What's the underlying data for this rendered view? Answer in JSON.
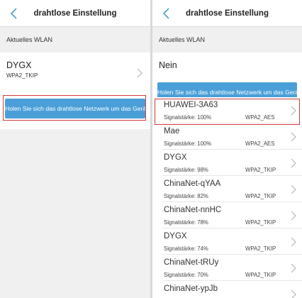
{
  "colors": {
    "accent": "#4a9fd8",
    "highlight": "#d23a3a"
  },
  "left": {
    "header": {
      "title": "drahtlose Einstellung",
      "back_icon": "chevron-left-icon"
    },
    "section_label": "Aktuelles WLAN",
    "current": {
      "name": "DYGX",
      "security": "WPA2_TKIP"
    },
    "fetch_button": "Holen Sie sich das drahtlose Netzwerk um das Gerät"
  },
  "right": {
    "header": {
      "title": "drahtlose Einstellung",
      "back_icon": "chevron-left-icon"
    },
    "section_label": "Aktuelles WLAN",
    "current": {
      "name": "Nein"
    },
    "fetch_button": "Holen Sie sich das drahtlose Netzwerk um das Gerät",
    "networks": [
      {
        "name": "HUAWEI-3A63",
        "strength": "Signalstärke: 100%",
        "security": "WPA2_AES"
      },
      {
        "name": "Mae",
        "strength": "Signalstärke: 100%",
        "security": "WPA2_AES"
      },
      {
        "name": "DYGX",
        "strength": "Signalstärke: 98%",
        "security": "WPA2_TKIP"
      },
      {
        "name": "ChinaNet-qYAA",
        "strength": "Signalstärke: 82%",
        "security": "WPA2_TKIP"
      },
      {
        "name": "ChinaNet-nnHC",
        "strength": "Signalstärke: 78%",
        "security": "WPA2_TKIP"
      },
      {
        "name": "DYGX",
        "strength": "Signalstärke: 74%",
        "security": "WPA2_TKIP"
      },
      {
        "name": "ChinaNet-tRUy",
        "strength": "Signalstärke: 70%",
        "security": "WPA2_TKIP"
      },
      {
        "name": "ChinaNet-ypJb",
        "strength": "",
        "security": ""
      }
    ]
  }
}
